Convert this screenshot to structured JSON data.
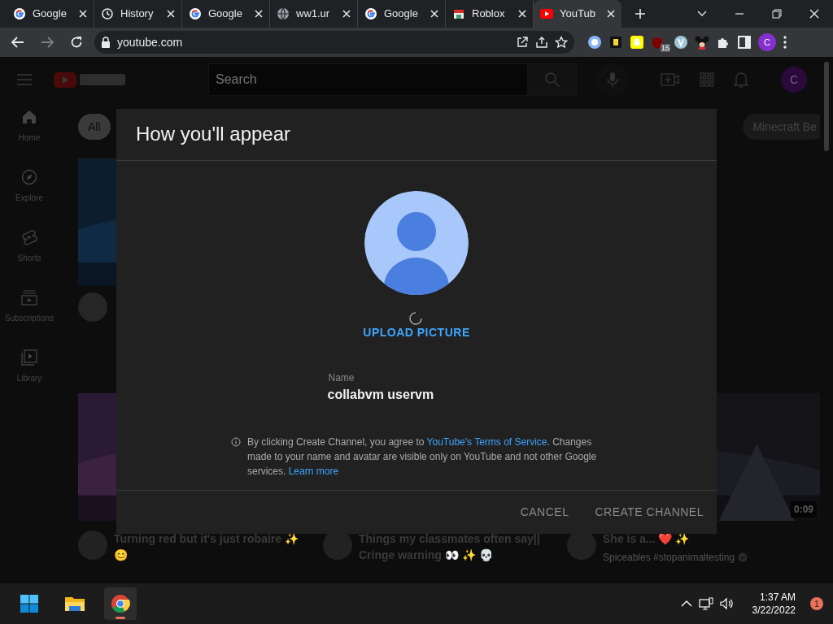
{
  "browser": {
    "tabs": [
      {
        "title": "Google",
        "kind": "google",
        "selected": false
      },
      {
        "title": "History",
        "kind": "history",
        "selected": false
      },
      {
        "title": "Google",
        "kind": "google",
        "selected": false
      },
      {
        "title": "ww1.ur",
        "kind": "globe",
        "selected": false
      },
      {
        "title": "Google",
        "kind": "google",
        "selected": false
      },
      {
        "title": "Roblox",
        "kind": "game",
        "selected": false
      },
      {
        "title": "YouTub",
        "kind": "video",
        "selected": true
      }
    ],
    "address": "youtube.com",
    "extension_badge": "15",
    "profile_initial": "C"
  },
  "youtube": {
    "search_placeholder": "Search",
    "avatar_initial": "C",
    "sidebar": [
      {
        "label": "Home",
        "kind": "home"
      },
      {
        "label": "Explore",
        "kind": "explore"
      },
      {
        "label": "Shorts",
        "kind": "shorts"
      },
      {
        "label": "Subscriptions",
        "kind": "subscriptions"
      },
      {
        "label": "Library",
        "kind": "library"
      }
    ],
    "chips": [
      {
        "label": "All",
        "selected": true
      },
      {
        "label": "Minecraft Be",
        "selected": false
      }
    ],
    "videos": [
      {
        "title": "Turning red but it's just robaire ✨ 😊"
      },
      {
        "title": "Things my classmates often say|| Cringe warning 👀 ✨ 💀"
      },
      {
        "title": "She is a... ❤️ ✨",
        "channel": "Spiceables #stopanimaltesting",
        "verified": true,
        "duration": "0:09"
      }
    ]
  },
  "dialog": {
    "title": "How you'll appear",
    "upload": "UPLOAD PICTURE",
    "loading": true,
    "field": {
      "label": "Name",
      "value": "collabvm uservm"
    },
    "notice": [
      {
        "text": "By clicking Create Channel, you agree to "
      },
      {
        "text": "YouTube's Terms of Service",
        "link": true
      },
      {
        "text": ". Changes made to your name and avatar are visible only on YouTube and not other Google services. "
      },
      {
        "text": "Learn more",
        "link": true
      }
    ],
    "buttons": [
      "CANCEL",
      "CREATE CHANNEL"
    ]
  },
  "taskbar": {
    "time": "1:37 AM",
    "date": "3/22/2022",
    "notifications": "1",
    "chrome_running": true
  }
}
